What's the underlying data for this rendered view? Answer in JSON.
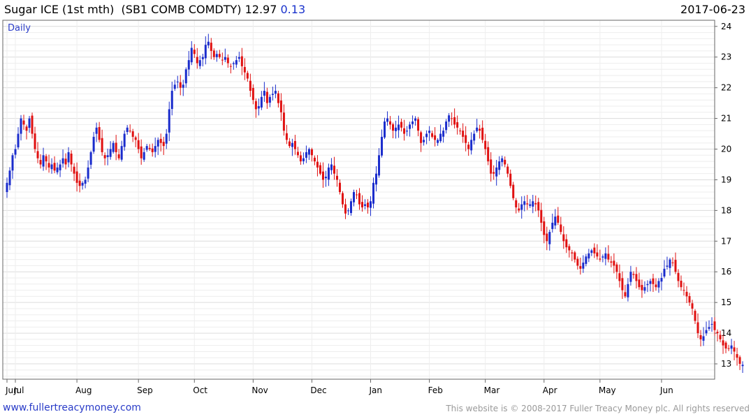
{
  "header": {
    "title": "Sugar ICE (1st mth)  (SB1 COMB COMDTY)",
    "last_price": "12.97",
    "change": "0.13",
    "date": "2017-06-23"
  },
  "footer": {
    "url": "www.fullertreacymoney.com",
    "copyright": "This website is © 2008-2017 Fuller Treacy Money plc. All rights reserved"
  },
  "colors": {
    "up": "#1a2ccc",
    "down": "#e01010",
    "grid": "#dcdcdc",
    "gridMinor": "#eeeeee",
    "frame": "#666666"
  },
  "chart_data": {
    "type": "candlestick",
    "period_label": "Daily",
    "ylim": [
      12.5,
      24.2
    ],
    "y_ticks": [
      13,
      14,
      15,
      16,
      17,
      18,
      19,
      20,
      21,
      22,
      23,
      24
    ],
    "x_labels": [
      {
        "label": "Jun",
        "day": 0
      },
      {
        "label": "Jul",
        "day": 3
      },
      {
        "label": "Aug",
        "day": 25
      },
      {
        "label": "Sep",
        "day": 47
      },
      {
        "label": "Oct",
        "day": 67
      },
      {
        "label": "Nov",
        "day": 88
      },
      {
        "label": "Dec",
        "day": 109
      },
      {
        "label": "Jan",
        "day": 130
      },
      {
        "label": "Feb",
        "day": 151
      },
      {
        "label": "Mar",
        "day": 171
      },
      {
        "label": "Apr",
        "day": 192
      },
      {
        "label": "May",
        "day": 212
      },
      {
        "label": "Jun",
        "day": 234
      }
    ],
    "day_count": 252,
    "closes": [
      18.9,
      19.3,
      19.8,
      20.0,
      20.5,
      21.0,
      20.8,
      20.6,
      21.0,
      20.5,
      20.0,
      19.7,
      19.5,
      19.8,
      19.6,
      19.4,
      19.5,
      19.3,
      19.4,
      19.5,
      19.7,
      19.5,
      19.9,
      19.5,
      19.2,
      18.9,
      18.8,
      18.9,
      19.0,
      19.4,
      19.9,
      20.4,
      20.7,
      20.3,
      19.9,
      19.7,
      19.8,
      20.0,
      20.2,
      19.9,
      19.7,
      20.1,
      20.5,
      20.7,
      20.6,
      20.4,
      20.3,
      20.0,
      19.7,
      19.9,
      20.1,
      20.0,
      19.9,
      20.1,
      20.3,
      20.2,
      20.1,
      20.5,
      21.3,
      21.9,
      22.1,
      22.2,
      22.0,
      22.1,
      22.6,
      22.9,
      23.3,
      23.1,
      22.8,
      22.9,
      23.0,
      23.4,
      23.5,
      23.2,
      23.0,
      23.1,
      23.0,
      22.9,
      23.0,
      22.8,
      22.7,
      22.8,
      22.9,
      23.0,
      22.7,
      22.5,
      22.3,
      21.9,
      21.6,
      21.3,
      21.4,
      21.7,
      21.9,
      21.5,
      21.7,
      21.8,
      21.9,
      21.5,
      21.2,
      20.6,
      20.3,
      20.1,
      20.2,
      20.0,
      19.8,
      19.6,
      19.7,
      19.9,
      20.0,
      19.8,
      19.6,
      19.4,
      19.2,
      19.0,
      19.1,
      19.4,
      19.5,
      19.2,
      19.0,
      18.6,
      18.2,
      17.9,
      18.0,
      18.3,
      18.6,
      18.5,
      18.2,
      18.1,
      18.2,
      18.1,
      18.3,
      18.9,
      19.2,
      19.8,
      20.4,
      20.9,
      21.0,
      20.8,
      20.6,
      20.7,
      20.8,
      20.7,
      20.5,
      20.6,
      20.8,
      20.9,
      21.0,
      20.6,
      20.2,
      20.3,
      20.5,
      20.6,
      20.4,
      20.3,
      20.3,
      20.5,
      20.6,
      20.9,
      21.1,
      21.0,
      20.8,
      20.7,
      20.6,
      20.4,
      20.2,
      20.0,
      20.3,
      20.5,
      20.7,
      20.6,
      20.3,
      20.0,
      19.6,
      19.2,
      19.2,
      19.4,
      19.6,
      19.7,
      19.5,
      19.2,
      18.8,
      18.4,
      18.1,
      18.0,
      18.2,
      18.3,
      18.2,
      18.2,
      18.3,
      18.2,
      18.0,
      17.6,
      17.2,
      17.0,
      17.3,
      17.6,
      17.8,
      17.6,
      17.3,
      17.0,
      16.8,
      16.7,
      16.6,
      16.4,
      16.2,
      16.1,
      16.3,
      16.5,
      16.6,
      16.7,
      16.6,
      16.5,
      16.4,
      16.5,
      16.6,
      16.4,
      16.3,
      16.2,
      16.0,
      15.7,
      15.4,
      15.2,
      15.6,
      16.0,
      15.9,
      15.7,
      15.5,
      15.4,
      15.5,
      15.6,
      15.7,
      15.6,
      15.5,
      15.7,
      15.8,
      16.1,
      16.2,
      16.4,
      16.3,
      16.0,
      15.7,
      15.5,
      15.4,
      15.2,
      15.0,
      14.8,
      14.4,
      14.0,
      13.8,
      13.9,
      14.1,
      14.2,
      14.3,
      14.1,
      14.0,
      13.8,
      13.6,
      13.5,
      13.5,
      13.6,
      13.4,
      13.2,
      13.0,
      12.97
    ]
  }
}
